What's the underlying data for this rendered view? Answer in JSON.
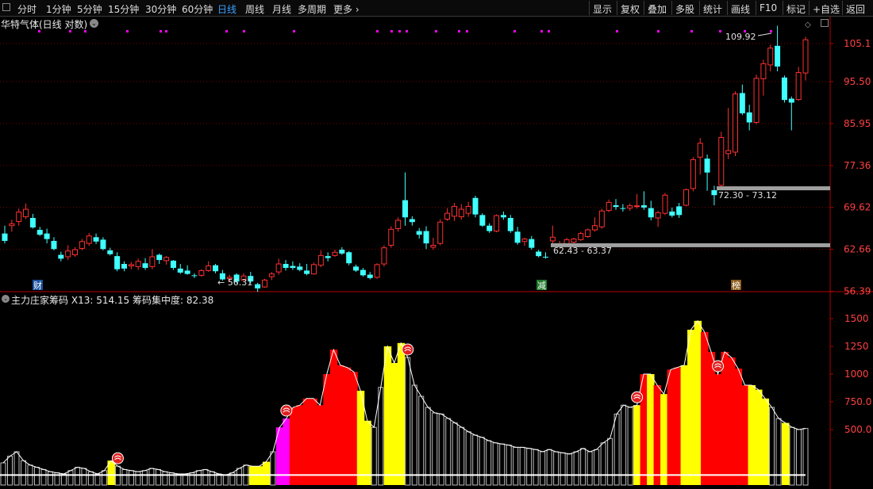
{
  "toolbar": {
    "tabs": [
      {
        "label": "分时",
        "active": false
      },
      {
        "label": "1分钟",
        "active": false
      },
      {
        "label": "5分钟",
        "active": false
      },
      {
        "label": "15分钟",
        "active": false
      },
      {
        "label": "30分钟",
        "active": false
      },
      {
        "label": "60分钟",
        "active": false
      },
      {
        "label": "日线",
        "active": true
      },
      {
        "label": "周线",
        "active": false
      },
      {
        "label": "月线",
        "active": false
      },
      {
        "label": "多周期",
        "active": false
      },
      {
        "label": "更多",
        "active": false
      }
    ],
    "right_buttons": [
      "显示",
      "复权",
      "叠加",
      "多股",
      "统计",
      "画线",
      "F10",
      "标记",
      "+自选",
      "返回"
    ]
  },
  "main_panel": {
    "title": "华特气体(日线 对数)",
    "y_ticks": [
      "105.1",
      "95.50",
      "85.95",
      "77.36",
      "69.62",
      "62.66",
      "56.39"
    ],
    "annotations": {
      "high": "109.92",
      "low": "56.31",
      "range1": "62.43 - 63.37",
      "range2": "72.30 - 73.12"
    },
    "badges": [
      "财",
      "减",
      "榜"
    ]
  },
  "indicator_panel": {
    "name": "主力庄家筹码",
    "x13_label": "X13: 514.15",
    "concentration_label": "筹码集中度: 82.38",
    "y_ticks": [
      "1500",
      "1250",
      "1000",
      "750.0",
      "500.0"
    ]
  },
  "chart_data": [
    {
      "type": "candlestick",
      "scale": "log",
      "ylim": [
        56.0,
        112.0
      ],
      "grid": true,
      "series": [
        {
          "o": 65.2,
          "h": 66.5,
          "l": 63.6,
          "c": 64.0
        },
        {
          "o": 66.5,
          "h": 67.5,
          "l": 65.5,
          "c": 66.8
        },
        {
          "o": 67.2,
          "h": 69.4,
          "l": 66.5,
          "c": 68.8
        },
        {
          "o": 68.0,
          "h": 70.3,
          "l": 67.6,
          "c": 69.3
        },
        {
          "o": 67.8,
          "h": 68.5,
          "l": 66.0,
          "c": 66.2
        },
        {
          "o": 65.8,
          "h": 66.3,
          "l": 64.8,
          "c": 65.0
        },
        {
          "o": 65.2,
          "h": 66.0,
          "l": 63.6,
          "c": 64.3
        },
        {
          "o": 64.0,
          "h": 64.6,
          "l": 62.5,
          "c": 62.7
        },
        {
          "o": 61.8,
          "h": 62.3,
          "l": 60.8,
          "c": 61.2
        },
        {
          "o": 61.5,
          "h": 63.3,
          "l": 61.0,
          "c": 62.4
        },
        {
          "o": 61.8,
          "h": 63.0,
          "l": 61.5,
          "c": 62.6
        },
        {
          "o": 62.8,
          "h": 64.3,
          "l": 62.5,
          "c": 63.9
        },
        {
          "o": 63.6,
          "h": 65.3,
          "l": 63.2,
          "c": 64.8
        },
        {
          "o": 64.6,
          "h": 65.2,
          "l": 63.5,
          "c": 63.9
        },
        {
          "o": 64.2,
          "h": 64.6,
          "l": 62.5,
          "c": 62.7
        },
        {
          "o": 62.5,
          "h": 62.9,
          "l": 61.7,
          "c": 61.9
        },
        {
          "o": 61.6,
          "h": 62.2,
          "l": 59.3,
          "c": 59.6
        },
        {
          "o": 60.4,
          "h": 60.8,
          "l": 59.3,
          "c": 59.7
        },
        {
          "o": 60.1,
          "h": 60.7,
          "l": 59.6,
          "c": 60.3
        },
        {
          "o": 60.0,
          "h": 61.2,
          "l": 59.5,
          "c": 60.8
        },
        {
          "o": 60.5,
          "h": 61.3,
          "l": 59.5,
          "c": 59.8
        },
        {
          "o": 60.0,
          "h": 62.7,
          "l": 59.6,
          "c": 61.5
        },
        {
          "o": 61.8,
          "h": 62.0,
          "l": 60.4,
          "c": 61.0
        },
        {
          "o": 60.9,
          "h": 61.6,
          "l": 60.3,
          "c": 61.4
        },
        {
          "o": 60.9,
          "h": 61.0,
          "l": 59.5,
          "c": 59.8
        },
        {
          "o": 59.7,
          "h": 60.4,
          "l": 58.9,
          "c": 59.1
        },
        {
          "o": 59.4,
          "h": 60.2,
          "l": 58.8,
          "c": 58.9
        },
        {
          "o": 58.7,
          "h": 59.0,
          "l": 58.3,
          "c": 58.6
        },
        {
          "o": 58.7,
          "h": 59.6,
          "l": 58.5,
          "c": 59.4
        },
        {
          "o": 59.4,
          "h": 60.8,
          "l": 59.2,
          "c": 60.1
        },
        {
          "o": 60.2,
          "h": 60.4,
          "l": 59.0,
          "c": 59.3
        },
        {
          "o": 59.0,
          "h": 59.5,
          "l": 57.9,
          "c": 58.1
        },
        {
          "o": 58.2,
          "h": 58.8,
          "l": 57.7,
          "c": 58.4
        },
        {
          "o": 58.8,
          "h": 59.0,
          "l": 57.5,
          "c": 57.8
        },
        {
          "o": 58.0,
          "h": 59.0,
          "l": 57.9,
          "c": 58.6
        },
        {
          "o": 58.6,
          "h": 59.2,
          "l": 57.5,
          "c": 57.8
        },
        {
          "o": 57.4,
          "h": 57.6,
          "l": 56.3,
          "c": 56.8
        },
        {
          "o": 57.0,
          "h": 58.2,
          "l": 56.9,
          "c": 58.0
        },
        {
          "o": 58.5,
          "h": 59.2,
          "l": 58.0,
          "c": 58.9
        },
        {
          "o": 59.2,
          "h": 61.2,
          "l": 58.8,
          "c": 60.4
        },
        {
          "o": 60.4,
          "h": 61.0,
          "l": 59.4,
          "c": 59.8
        },
        {
          "o": 60.1,
          "h": 60.8,
          "l": 59.5,
          "c": 59.8
        },
        {
          "o": 60.0,
          "h": 60.5,
          "l": 59.3,
          "c": 59.5
        },
        {
          "o": 59.4,
          "h": 60.4,
          "l": 58.7,
          "c": 58.9
        },
        {
          "o": 58.9,
          "h": 60.6,
          "l": 58.8,
          "c": 60.3
        },
        {
          "o": 60.2,
          "h": 62.5,
          "l": 59.9,
          "c": 61.7
        },
        {
          "o": 61.6,
          "h": 62.2,
          "l": 60.8,
          "c": 61.3
        },
        {
          "o": 61.7,
          "h": 62.6,
          "l": 61.5,
          "c": 62.2
        },
        {
          "o": 62.6,
          "h": 63.0,
          "l": 61.8,
          "c": 62.0
        },
        {
          "o": 62.2,
          "h": 62.4,
          "l": 60.2,
          "c": 60.5
        },
        {
          "o": 60.0,
          "h": 60.3,
          "l": 59.2,
          "c": 59.4
        },
        {
          "o": 59.5,
          "h": 59.8,
          "l": 58.5,
          "c": 58.7
        },
        {
          "o": 58.8,
          "h": 59.2,
          "l": 58.1,
          "c": 58.3
        },
        {
          "o": 58.4,
          "h": 60.5,
          "l": 58.2,
          "c": 60.3
        },
        {
          "o": 60.4,
          "h": 63.3,
          "l": 60.0,
          "c": 62.9
        },
        {
          "o": 63.3,
          "h": 66.4,
          "l": 62.9,
          "c": 65.9
        },
        {
          "o": 66.0,
          "h": 67.9,
          "l": 65.5,
          "c": 67.4
        },
        {
          "o": 70.9,
          "h": 76.0,
          "l": 66.5,
          "c": 67.9
        },
        {
          "o": 67.6,
          "h": 68.1,
          "l": 66.5,
          "c": 67.1
        },
        {
          "o": 65.6,
          "h": 66.1,
          "l": 64.4,
          "c": 65.0
        },
        {
          "o": 65.6,
          "h": 66.4,
          "l": 62.7,
          "c": 63.6
        },
        {
          "o": 63.0,
          "h": 64.5,
          "l": 62.6,
          "c": 63.3
        },
        {
          "o": 63.6,
          "h": 67.6,
          "l": 63.3,
          "c": 67.1
        },
        {
          "o": 67.6,
          "h": 69.5,
          "l": 67.3,
          "c": 68.6
        },
        {
          "o": 68.1,
          "h": 70.4,
          "l": 67.3,
          "c": 69.8
        },
        {
          "o": 68.0,
          "h": 70.2,
          "l": 67.5,
          "c": 69.3
        },
        {
          "o": 68.6,
          "h": 70.6,
          "l": 68.0,
          "c": 69.8
        },
        {
          "o": 71.3,
          "h": 71.7,
          "l": 67.9,
          "c": 68.4
        },
        {
          "o": 68.3,
          "h": 68.6,
          "l": 66.3,
          "c": 66.5
        },
        {
          "o": 66.5,
          "h": 66.9,
          "l": 65.3,
          "c": 65.6
        },
        {
          "o": 65.6,
          "h": 68.4,
          "l": 65.4,
          "c": 68.2
        },
        {
          "o": 68.3,
          "h": 68.9,
          "l": 67.5,
          "c": 67.9
        },
        {
          "o": 67.8,
          "h": 68.3,
          "l": 65.3,
          "c": 65.6
        },
        {
          "o": 65.5,
          "h": 66.3,
          "l": 63.4,
          "c": 63.7
        },
        {
          "o": 63.9,
          "h": 64.5,
          "l": 63.2,
          "c": 64.3
        },
        {
          "o": 64.3,
          "h": 64.8,
          "l": 62.6,
          "c": 62.9
        },
        {
          "o": 62.3,
          "h": 62.6,
          "l": 61.4,
          "c": 61.6
        },
        {
          "o": 61.5,
          "h": 62.2,
          "l": 61.2,
          "c": 61.4
        },
        {
          "o": 64.0,
          "h": 66.5,
          "l": 63.4,
          "c": 64.6
        },
        {
          "o": 63.5,
          "h": 64.0,
          "l": 63.0,
          "c": 63.5
        },
        {
          "o": 63.4,
          "h": 64.5,
          "l": 63.2,
          "c": 64.2
        },
        {
          "o": 63.8,
          "h": 64.5,
          "l": 63.6,
          "c": 64.3
        },
        {
          "o": 64.2,
          "h": 65.5,
          "l": 64.0,
          "c": 65.2
        },
        {
          "o": 64.7,
          "h": 66.0,
          "l": 64.5,
          "c": 65.8
        },
        {
          "o": 65.8,
          "h": 67.9,
          "l": 65.5,
          "c": 66.5
        },
        {
          "o": 66.3,
          "h": 69.4,
          "l": 66.0,
          "c": 69.0
        },
        {
          "o": 69.1,
          "h": 71.0,
          "l": 68.8,
          "c": 70.5
        },
        {
          "o": 70.0,
          "h": 71.1,
          "l": 69.2,
          "c": 69.7
        },
        {
          "o": 69.5,
          "h": 70.2,
          "l": 68.9,
          "c": 69.4
        },
        {
          "o": 69.5,
          "h": 70.3,
          "l": 69.0,
          "c": 69.9
        },
        {
          "o": 69.8,
          "h": 72.0,
          "l": 69.4,
          "c": 69.9
        },
        {
          "o": 70.0,
          "h": 72.5,
          "l": 69.2,
          "c": 69.6
        },
        {
          "o": 69.5,
          "h": 70.8,
          "l": 67.4,
          "c": 67.9
        },
        {
          "o": 67.8,
          "h": 69.0,
          "l": 66.3,
          "c": 68.7
        },
        {
          "o": 68.6,
          "h": 72.2,
          "l": 68.3,
          "c": 71.8
        },
        {
          "o": 68.9,
          "h": 69.6,
          "l": 67.9,
          "c": 68.2
        },
        {
          "o": 69.8,
          "h": 70.4,
          "l": 67.8,
          "c": 68.3
        },
        {
          "o": 70.0,
          "h": 73.0,
          "l": 69.8,
          "c": 72.8
        },
        {
          "o": 73.0,
          "h": 79.0,
          "l": 72.5,
          "c": 78.5
        },
        {
          "o": 79.0,
          "h": 82.9,
          "l": 75.6,
          "c": 81.8
        },
        {
          "o": 78.7,
          "h": 79.5,
          "l": 72.6,
          "c": 76.0
        },
        {
          "o": 72.7,
          "h": 73.5,
          "l": 70.0,
          "c": 71.8
        },
        {
          "o": 73.6,
          "h": 84.2,
          "l": 73.0,
          "c": 83.0
        },
        {
          "o": 79.7,
          "h": 89.4,
          "l": 78.6,
          "c": 80.3
        },
        {
          "o": 80.0,
          "h": 93.2,
          "l": 79.2,
          "c": 92.6
        },
        {
          "o": 92.8,
          "h": 94.8,
          "l": 87.8,
          "c": 88.2
        },
        {
          "o": 88.4,
          "h": 90.1,
          "l": 84.5,
          "c": 86.2
        },
        {
          "o": 86.2,
          "h": 97.2,
          "l": 85.8,
          "c": 96.3
        },
        {
          "o": 96.2,
          "h": 100.9,
          "l": 92.2,
          "c": 99.9
        },
        {
          "o": 99.6,
          "h": 104.8,
          "l": 98.0,
          "c": 103.9
        },
        {
          "o": 104.5,
          "h": 109.9,
          "l": 98.0,
          "c": 99.2
        },
        {
          "o": 96.5,
          "h": 97.0,
          "l": 90.6,
          "c": 91.2
        },
        {
          "o": 91.5,
          "h": 92.0,
          "l": 84.5,
          "c": 90.6
        },
        {
          "o": 91.3,
          "h": 99.1,
          "l": 91.0,
          "c": 97.7
        },
        {
          "o": 97.6,
          "h": 106.9,
          "l": 95.8,
          "c": 106.1
        }
      ],
      "annotations": {
        "max": 109.92,
        "min": 56.31,
        "zone1": [
          62.43,
          63.37
        ],
        "zone2": [
          72.3,
          73.12
        ]
      }
    },
    {
      "type": "bar",
      "ylim": [
        0,
        1600
      ],
      "grid": true,
      "colors": {
        "w": "#bbbbbb",
        "y": "#ffff00",
        "r": "#ff0000",
        "m": "#ff00ff"
      },
      "values": [
        200,
        260,
        300,
        220,
        180,
        160,
        140,
        120,
        110,
        100,
        130,
        160,
        150,
        120,
        100,
        130,
        220,
        170,
        140,
        130,
        120,
        130,
        150,
        140,
        120,
        110,
        100,
        100,
        110,
        130,
        140,
        120,
        100,
        90,
        110,
        150,
        180,
        170,
        170,
        210,
        300,
        520,
        600,
        700,
        720,
        780,
        780,
        720,
        1000,
        1220,
        1080,
        1060,
        1020,
        850,
        580,
        520,
        880,
        1250,
        1100,
        1280,
        1150,
        900,
        800,
        700,
        650,
        640,
        600,
        560,
        520,
        480,
        450,
        430,
        400,
        380,
        370,
        360,
        340,
        340,
        330,
        320,
        300,
        320,
        300,
        290,
        280,
        300,
        330,
        300,
        320,
        380,
        420,
        640,
        720,
        700,
        720,
        1000,
        1000,
        900,
        820,
        1040,
        1060,
        1080,
        1400,
        1480,
        1380,
        1200,
        1000,
        1200,
        1150,
        1050,
        900,
        900,
        860,
        780,
        700,
        600,
        560,
        520,
        500,
        510
      ],
      "colors_per_bar": "wwwwwwwwwwwwwwwwywwwwwwwwwwwwwwwwwwwwyyywmmrrrrrrrrrryywwyyywwwwwwwwwwwwwwwwwwwwwwwwwwwwwwwwwwyryryrryyyrrrrrrryyywwywwwwwwwwwwwww",
      "baseline_line": true,
      "markers": [
        17,
        42,
        60,
        94,
        106
      ]
    }
  ]
}
